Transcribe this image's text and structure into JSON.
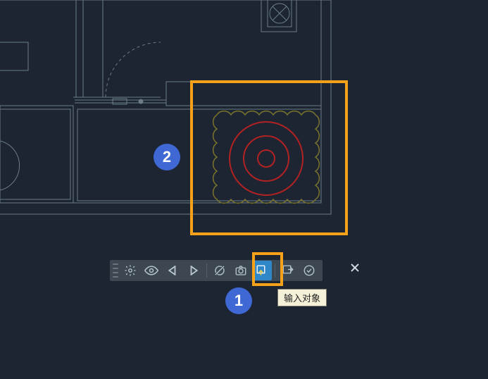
{
  "annotations": {
    "callout_1": "1",
    "callout_2": "2"
  },
  "toolbar": {
    "tooltip_input_object": "输入对象",
    "buttons": {
      "settings": "settings-icon",
      "visibility": "eye-icon",
      "step_back": "step-back-icon",
      "step_forward": "step-forward-icon",
      "isolate": "isolate-icon",
      "snapshot": "snapshot-icon",
      "input_object": "input-object-icon",
      "output_object": "output-object-icon",
      "confirm": "confirm-icon",
      "close": "close-icon"
    }
  },
  "colors": {
    "highlight": "#f6a11a",
    "callout_bg": "#3f68d4",
    "drawing_stroke": "#6a7d87",
    "rug_stroke": "#7c742e",
    "target_stroke": "#b22222",
    "toolbar_bg": "#3d4751",
    "toolbar_active": "#2f87c8"
  }
}
